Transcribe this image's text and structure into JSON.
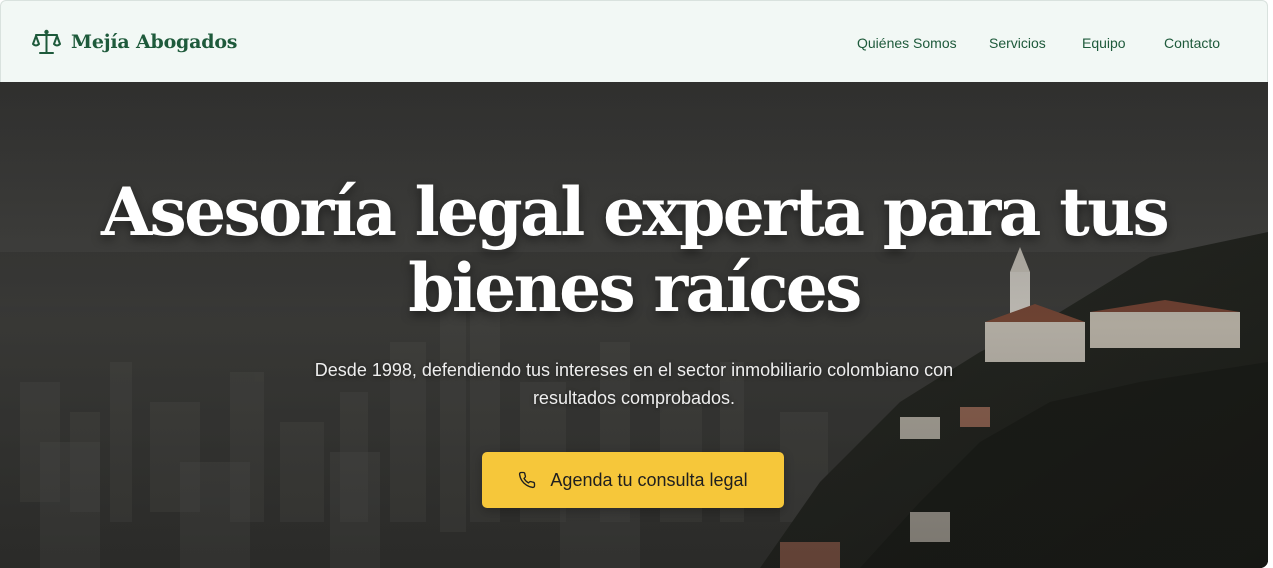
{
  "brand": {
    "name": "Mejía Abogados",
    "icon": "scales-icon",
    "color": "#1e5a3b"
  },
  "nav": {
    "items": [
      {
        "label": "Quiénes Somos"
      },
      {
        "label": "Servicios"
      },
      {
        "label": "Equipo"
      },
      {
        "label": "Contacto"
      }
    ]
  },
  "hero": {
    "title": "Asesoría legal experta para tus bienes raíces",
    "subtitle": "Desde 1998, defendiendo tus intereses en el sector inmobiliario colombiano con resultados comprobados.",
    "cta": {
      "label": "Agenda tu consulta legal",
      "icon": "phone-icon"
    },
    "background": "aerial city view with hilltop church"
  },
  "colors": {
    "accent": "#f6c73a",
    "brand": "#1e5a3b",
    "navbar_bg": "#f2f8f5"
  }
}
